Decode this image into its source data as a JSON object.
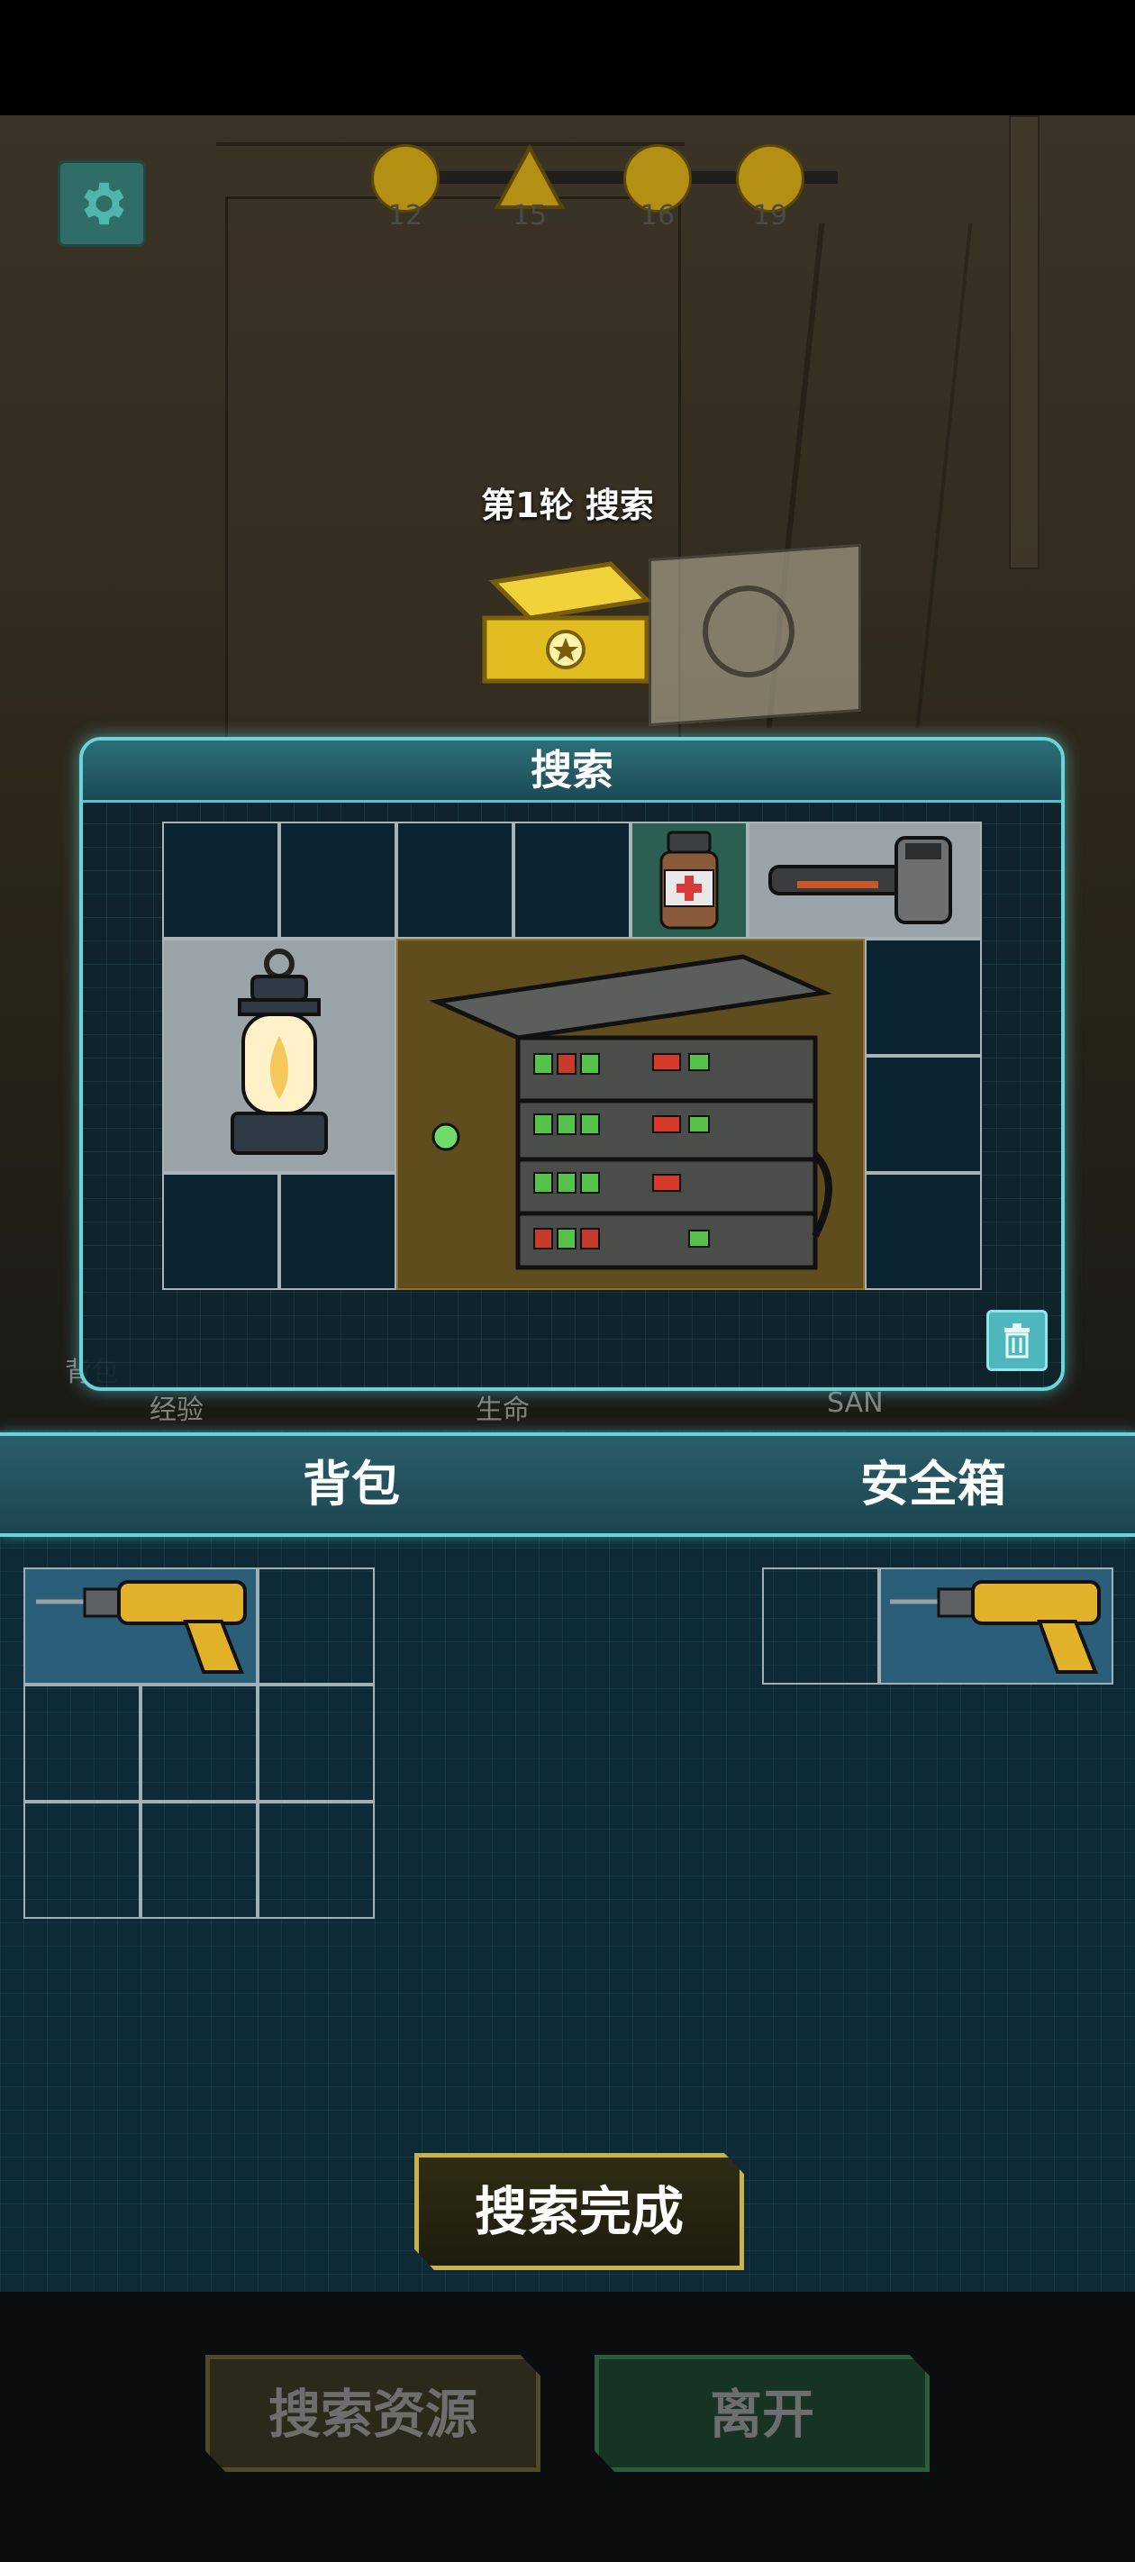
{
  "timeline": {
    "nodes": [
      {
        "value": "12",
        "icon": "bulb-icon"
      },
      {
        "value": "15",
        "icon": "warning-triangle-icon"
      },
      {
        "value": "16",
        "icon": "bulb-icon"
      },
      {
        "value": "19",
        "icon": "bulb-icon"
      }
    ]
  },
  "round_title": "第1轮 搜索",
  "stats": {
    "bag": "背包",
    "exp": "经验",
    "hp": "生命",
    "san": "SAN"
  },
  "search_panel": {
    "title": "搜索"
  },
  "inventory": {
    "backpack_label": "背包",
    "safebox_label": "安全箱"
  },
  "buttons": {
    "done": "搜索完成",
    "search_resources": "搜索资源",
    "leave": "离开"
  },
  "colors": {
    "accent": "#6ad4d8",
    "gold": "#c9b24a",
    "panel": "#0e242e"
  }
}
